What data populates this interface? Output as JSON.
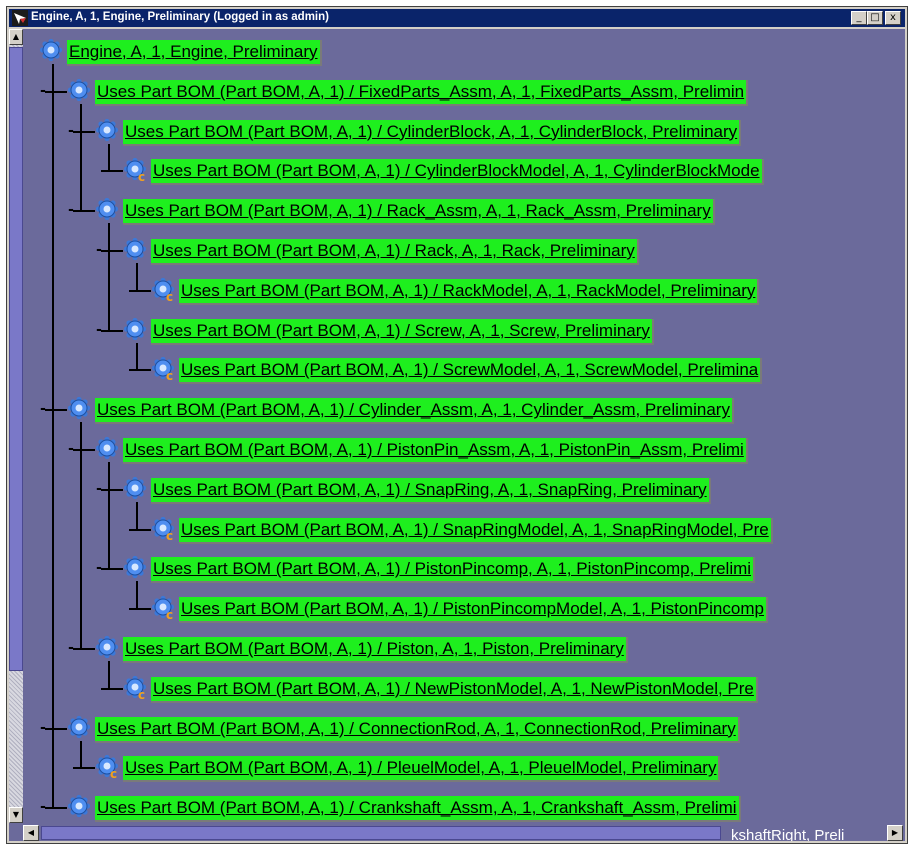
{
  "window": {
    "title": "Engine, A, 1, Engine, Preliminary (Logged in as admin)",
    "min_label": "_",
    "max_label": "□",
    "close_label": "x"
  },
  "colors": {
    "label_bg": "#1eef1e",
    "client_bg": "#6b6a9b",
    "titlebar": "#0a246a"
  },
  "tree": {
    "root": {
      "label": "Engine, A, 1, Engine, Preliminary"
    },
    "nodes": [
      {
        "label": "Uses Part BOM (Part BOM, A, 1) / FixedParts_Assm, A, 1, FixedParts_Assm, Prelimin",
        "icon": "assembly-gear-icon",
        "expanded": true
      },
      {
        "label": "Uses Part BOM (Part BOM, A, 1) / CylinderBlock, A, 1, CylinderBlock, Preliminary",
        "icon": "assembly-gear-icon",
        "expanded": true
      },
      {
        "label": "Uses Part BOM (Part BOM, A, 1) / CylinderBlockModel, A, 1, CylinderBlockMode",
        "icon": "model-gear-icon"
      },
      {
        "label": "Uses Part BOM (Part BOM, A, 1) / Rack_Assm, A, 1, Rack_Assm, Preliminary",
        "icon": "assembly-gear-icon",
        "expanded": true
      },
      {
        "label": "Uses Part BOM (Part BOM, A, 1) / Rack, A, 1, Rack, Preliminary",
        "icon": "assembly-gear-icon",
        "expanded": true
      },
      {
        "label": "Uses Part BOM (Part BOM, A, 1) / RackModel, A, 1, RackModel, Preliminary",
        "icon": "model-gear-icon"
      },
      {
        "label": "Uses Part BOM (Part BOM, A, 1) / Screw, A, 1, Screw, Preliminary",
        "icon": "assembly-gear-icon",
        "expanded": true
      },
      {
        "label": "Uses Part BOM (Part BOM, A, 1) / ScrewModel, A, 1, ScrewModel, Prelimina",
        "icon": "model-gear-icon"
      },
      {
        "label": "Uses Part BOM (Part BOM, A, 1) / Cylinder_Assm, A, 1, Cylinder_Assm, Preliminary",
        "icon": "assembly-gear-icon",
        "expanded": true
      },
      {
        "label": "Uses Part BOM (Part BOM, A, 1) / PistonPin_Assm, A, 1, PistonPin_Assm, Prelimi",
        "icon": "assembly-gear-icon",
        "expanded": true
      },
      {
        "label": "Uses Part BOM (Part BOM, A, 1) / SnapRing, A, 1, SnapRing, Preliminary",
        "icon": "assembly-gear-icon",
        "expanded": true
      },
      {
        "label": "Uses Part BOM (Part BOM, A, 1) / SnapRingModel, A, 1, SnapRingModel, Pre",
        "icon": "model-gear-icon"
      },
      {
        "label": "Uses Part BOM (Part BOM, A, 1) / PistonPincomp, A, 1, PistonPincomp, Prelimi",
        "icon": "assembly-gear-icon",
        "expanded": true
      },
      {
        "label": "Uses Part BOM (Part BOM, A, 1) / PistonPincompModel, A, 1, PistonPincomp",
        "icon": "model-gear-icon"
      },
      {
        "label": "Uses Part BOM (Part BOM, A, 1) / Piston, A, 1, Piston, Preliminary",
        "icon": "assembly-gear-icon",
        "expanded": true
      },
      {
        "label": "Uses Part BOM (Part BOM, A, 1) / NewPistonModel, A, 1, NewPistonModel, Pre",
        "icon": "model-gear-icon"
      },
      {
        "label": "Uses Part BOM (Part BOM, A, 1) / ConnectionRod, A, 1, ConnectionRod, Preliminary",
        "icon": "assembly-gear-icon",
        "expanded": true
      },
      {
        "label": "Uses Part BOM (Part BOM, A, 1) / PleuelModel, A, 1, PleuelModel, Preliminary",
        "icon": "model-gear-icon"
      },
      {
        "label": "Uses Part BOM (Part BOM, A, 1) / Crankshaft_Assm, A, 1, Crankshaft_Assm, Prelimi",
        "icon": "assembly-gear-icon",
        "expanded": true
      }
    ],
    "clipped_bottom_text": "kshaftRight, Preli"
  }
}
